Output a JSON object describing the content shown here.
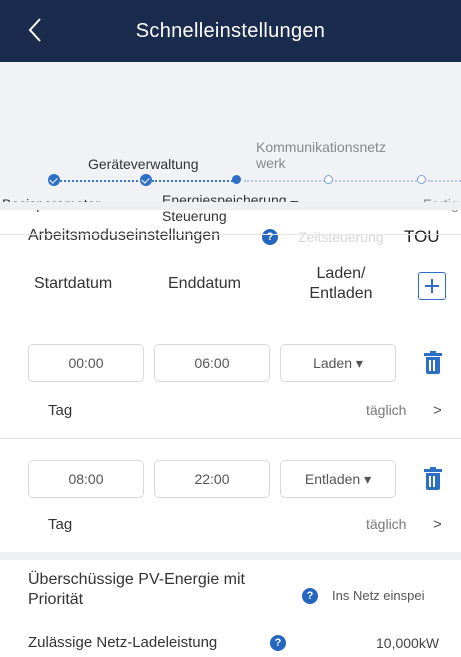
{
  "header": {
    "title": "Schnelleinstellungen"
  },
  "steps": {
    "items": [
      {
        "label": "Basisparameter"
      },
      {
        "label": "Geräteverwaltung"
      },
      {
        "label_line1": "Energiespeicherung –",
        "label_line2": "Steuerung"
      },
      {
        "label_line1": "Kommunikationsnetz",
        "label_line2": "werk"
      },
      {
        "label": "Fertig"
      }
    ]
  },
  "mode": {
    "label": "Arbeitsmoduseinstellungen",
    "help": "?",
    "faded": "Zeitsteuerung",
    "value": "TOU"
  },
  "columns": {
    "start": "Startdatum",
    "end": "Enddatum",
    "charge_line1": "Laden/",
    "charge_line2": "Entladen"
  },
  "schedule": [
    {
      "start": "00:00",
      "end": "06:00",
      "mode": "Laden ▾",
      "tag_label": "Tag",
      "tag_value": "täglich",
      "chevron": ">"
    },
    {
      "start": "08:00",
      "end": "22:00",
      "mode": "Entladen ▾",
      "tag_label": "Tag",
      "tag_value": "täglich",
      "chevron": ">"
    }
  ],
  "pv": {
    "label": "Überschüssige PV-Energie mit Priorität",
    "help": "?",
    "value": "Ins Netz einspei"
  },
  "grid": {
    "label": "Zulässige Netz-Ladeleistung",
    "help": "?",
    "value": "10,000kW"
  },
  "colors": {
    "header_bg": "#1a2b4d",
    "accent": "#2d6fc4",
    "step_bg": "#f1f2f5"
  }
}
